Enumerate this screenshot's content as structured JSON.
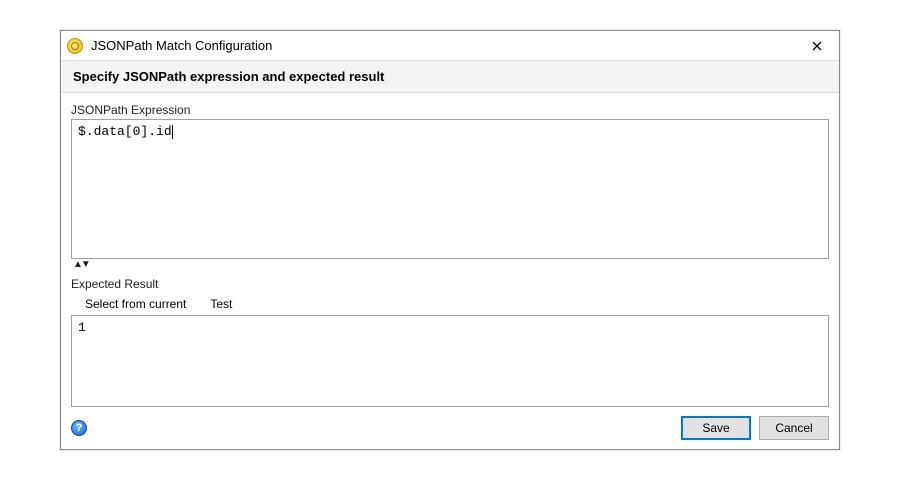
{
  "titlebar": {
    "title": "JSONPath Match Configuration"
  },
  "subheader": "Specify JSONPath expression and expected result",
  "expression": {
    "label": "JSONPath Expression",
    "value": "$.data[0].id"
  },
  "expected": {
    "label": "Expected Result",
    "select_label": "Select from current",
    "test_label": "Test",
    "value": "1"
  },
  "footer": {
    "save": "Save",
    "cancel": "Cancel",
    "help_glyph": "?"
  }
}
